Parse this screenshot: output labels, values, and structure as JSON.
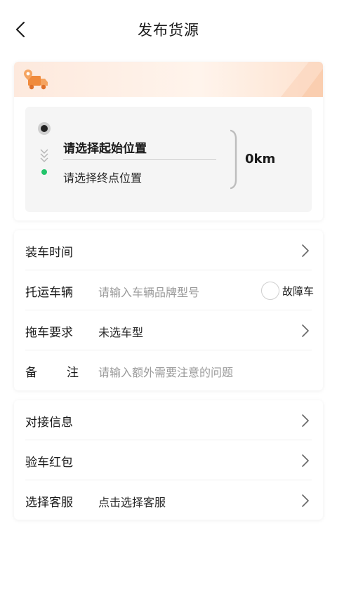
{
  "header": {
    "title": "发布货源",
    "back_icon": "chevron-left-icon"
  },
  "route": {
    "start_placeholder": "请选择起始位置",
    "end_placeholder": "请选择终点位置",
    "distance": "0km",
    "banner_icon": "truck-location-icon",
    "start_dot_color": "#222222",
    "end_dot_color": "#22c46a"
  },
  "form": {
    "load_time": {
      "label": "装车时间",
      "value": ""
    },
    "vehicle": {
      "label": "托运车辆",
      "placeholder": "请输入车辆品牌型号",
      "breakdown_label": "故障车"
    },
    "tow_requirement": {
      "label": "拖车要求",
      "value": "未选车型"
    },
    "remarks": {
      "label": "备注",
      "placeholder": "请输入额外需要注意的问题"
    }
  },
  "contact": {
    "docking_info": {
      "label": "对接信息"
    },
    "inspection_bonus": {
      "label": "验车红包"
    },
    "customer_service": {
      "label": "选择客服",
      "value": "点击选择客服"
    }
  }
}
